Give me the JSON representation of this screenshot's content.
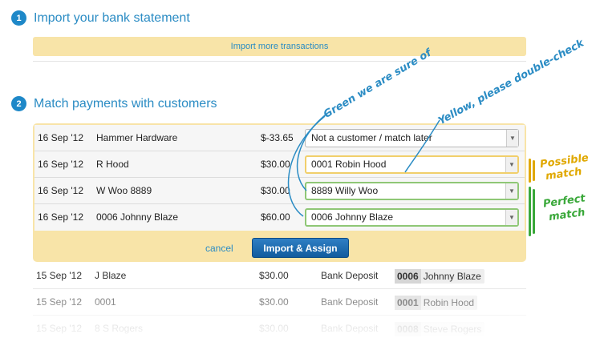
{
  "step1": {
    "number": "1",
    "title": "Import your bank statement",
    "import_more_label": "Import more transactions"
  },
  "step2": {
    "number": "2",
    "title": "Match payments with customers",
    "rows": [
      {
        "date": "16 Sep '12",
        "description": "Hammer Hardware",
        "amount": "$-33.65",
        "match": "Not a customer / match later",
        "state": "none"
      },
      {
        "date": "16 Sep '12",
        "description": "R Hood",
        "amount": "$30.00",
        "match": "0001 Robin Hood",
        "state": "possible"
      },
      {
        "date": "16 Sep '12",
        "description": "W Woo 8889",
        "amount": "$30.00",
        "match": "8889 Willy Woo",
        "state": "perfect"
      },
      {
        "date": "16 Sep '12",
        "description": "0006 Johnny Blaze",
        "amount": "$60.00",
        "match": "0006 Johnny Blaze",
        "state": "perfect"
      }
    ],
    "cancel_label": "cancel",
    "import_assign_label": "Import & Assign"
  },
  "history": [
    {
      "date": "15 Sep '12",
      "description": "J Blaze",
      "amount": "$30.00",
      "type": "Bank Deposit",
      "customer_id": "0006",
      "customer_name": "Johnny Blaze"
    },
    {
      "date": "15 Sep '12",
      "description": "0001",
      "amount": "$30.00",
      "type": "Bank Deposit",
      "customer_id": "0001",
      "customer_name": "Robin Hood"
    },
    {
      "date": "15 Sep '12",
      "description": "8 S Rogers",
      "amount": "$30.00",
      "type": "Bank Deposit",
      "customer_id": "0008",
      "customer_name": "Steve Rogers"
    }
  ],
  "annotations": {
    "green_note": "Green we are sure of",
    "yellow_note": "Yellow, please double-check",
    "possible_line1": "Possible",
    "possible_line2": "match",
    "perfect_line1": "Perfect",
    "perfect_line2": "match"
  },
  "colors": {
    "accent": "#2b8cc4",
    "panel": "#f8e4a8",
    "possible": "#f1cf6b",
    "perfect": "#8fc776",
    "button": "#1a68ad"
  },
  "icons": {
    "dropdown": "chevron-down-icon"
  }
}
